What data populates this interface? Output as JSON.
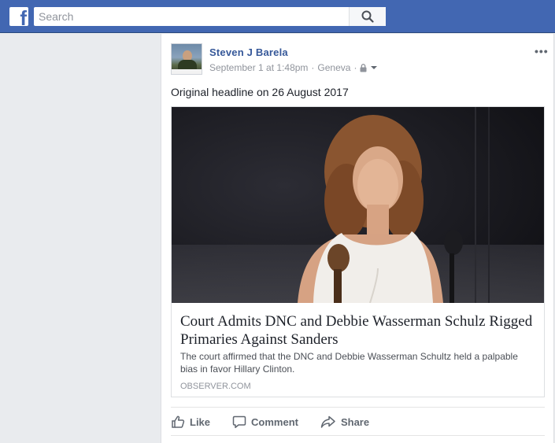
{
  "topbar": {
    "logo": "f",
    "search_placeholder": "Search",
    "search_icon": "search-icon"
  },
  "post": {
    "author": "Steven J Barela",
    "timestamp": "September 1 at 1:48pm",
    "location": "Geneva",
    "separator": "·",
    "privacy_icon": "lock-icon",
    "menu_icon": "more-icon",
    "menu_label": "•••",
    "text": "Original headline on 26 August 2017",
    "link": {
      "title": "Court Admits DNC and Debbie Wasserman Schulz Rigged Primaries Against Sanders",
      "description": "The court affirmed that the DNC and Debbie Wasserman Schultz held a palpable bias in favor Hillary Clinton.",
      "domain": "OBSERVER.COM"
    },
    "actions": {
      "like": "Like",
      "comment": "Comment",
      "share": "Share"
    }
  },
  "colors": {
    "brand": "#4267b2",
    "link_name": "#365899",
    "meta_gray": "#90949c"
  }
}
